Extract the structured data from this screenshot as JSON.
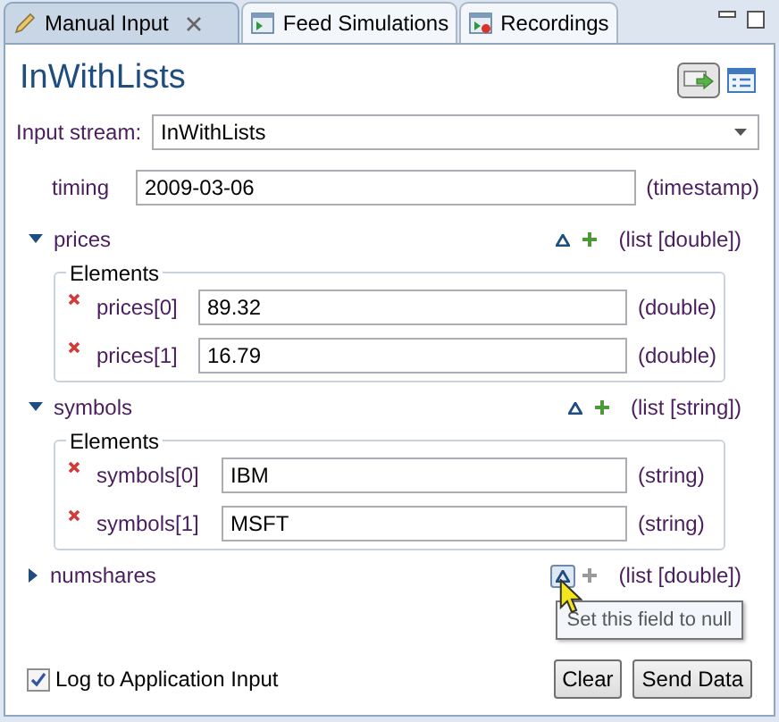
{
  "tabs": [
    {
      "label": "Manual Input",
      "selected": true,
      "closable": true
    },
    {
      "label": "Feed Simulations",
      "selected": false,
      "closable": false
    },
    {
      "label": "Recordings",
      "selected": false,
      "closable": false
    }
  ],
  "title": "InWithLists",
  "input_stream": {
    "label": "Input stream:",
    "value": "InWithLists"
  },
  "fields": [
    {
      "kind": "scalar",
      "name": "timing",
      "value": "2009-03-06",
      "type": "(timestamp)"
    },
    {
      "kind": "list",
      "name": "prices",
      "expanded": true,
      "null_hovered": false,
      "type": "(list [double])",
      "group_label": "Elements",
      "items": [
        {
          "name": "prices[0]",
          "value": "89.32",
          "type": "(double)"
        },
        {
          "name": "prices[1]",
          "value": "16.79",
          "type": "(double)"
        }
      ]
    },
    {
      "kind": "list",
      "name": "symbols",
      "expanded": true,
      "null_hovered": false,
      "type": "(list [string])",
      "group_label": "Elements",
      "items": [
        {
          "name": "symbols[0]",
          "value": "IBM",
          "type": "(string)"
        },
        {
          "name": "symbols[1]",
          "value": "MSFT",
          "type": "(string)"
        }
      ]
    },
    {
      "kind": "list",
      "name": "numshares",
      "expanded": false,
      "null_hovered": true,
      "type": "(list [double])"
    }
  ],
  "tooltip": "Set this field to null",
  "log": {
    "label": "Log to Application Input",
    "checked": true
  },
  "buttons": [
    "Clear",
    "Send Data"
  ]
}
